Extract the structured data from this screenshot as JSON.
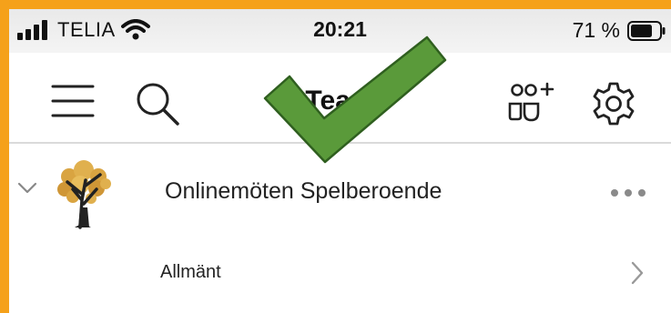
{
  "status_bar": {
    "carrier": "TELIA",
    "time": "20:21",
    "battery": "71 %"
  },
  "nav": {
    "title": "Team",
    "icons": [
      "menu-icon",
      "search-icon",
      "add-people-icon",
      "settings-icon"
    ]
  },
  "teams": [
    {
      "name": "Onlinemöten Spelberoende",
      "expanded": true,
      "channels": [
        {
          "name": "Allmänt"
        }
      ]
    }
  ],
  "colors": {
    "frame": "#f5a11a",
    "checkmark": "#5a9a3a"
  }
}
